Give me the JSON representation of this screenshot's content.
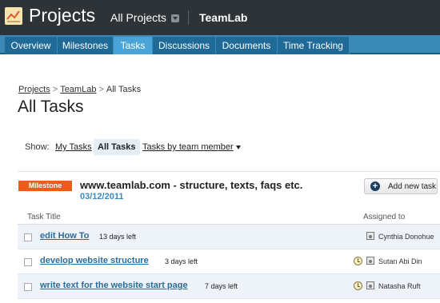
{
  "header": {
    "app_title": "Projects",
    "project_switch": "All Projects",
    "portal_name": "TeamLab"
  },
  "tabs": [
    {
      "label": "Overview",
      "active": false
    },
    {
      "label": "Milestones",
      "active": false
    },
    {
      "label": "Tasks",
      "active": true
    },
    {
      "label": "Discussions",
      "active": false
    },
    {
      "label": "Documents",
      "active": false
    },
    {
      "label": "Time Tracking",
      "active": false
    }
  ],
  "breadcrumb": {
    "items": [
      "Projects",
      "TeamLab",
      "All Tasks"
    ],
    "separator": ">"
  },
  "page_title": "All Tasks",
  "filters": {
    "show_label": "Show:",
    "my_tasks": "My Tasks",
    "all_tasks": "All Tasks",
    "by_member": "Tasks by team member"
  },
  "milestone": {
    "badge": "Milestone",
    "title": "www.teamlab.com - structure, texts, faqs etc.",
    "date": "03/12/2011",
    "add_task_label": "Add new task"
  },
  "table": {
    "col_task_title": "Task Title",
    "col_assigned_to": "Assigned to",
    "rows": [
      {
        "title": "edit How To",
        "due": "13 days left",
        "assignee": "Cynthia Donohue",
        "has_clock": false
      },
      {
        "title": "develop website structure",
        "due": "3 days left",
        "assignee": "Sutan Abi Din",
        "has_clock": true
      },
      {
        "title": "write text for the website start page",
        "due": "7 days left",
        "assignee": "Natasha Ruft",
        "has_clock": true
      }
    ]
  },
  "colors": {
    "topbar": "#2e3338",
    "tabbar": "#3b8ab6",
    "tab": "#1f6a96",
    "tab_active": "#4aa4d8",
    "milestone_badge": "#f05a1a",
    "link": "#2a6d9c",
    "date": "#3a8bc0"
  },
  "icons": {
    "logo": "projects-logo-icon",
    "dropdown": "chevron-down-icon",
    "add": "plus-circle-icon",
    "clock": "clock-icon",
    "person": "user-icon"
  }
}
